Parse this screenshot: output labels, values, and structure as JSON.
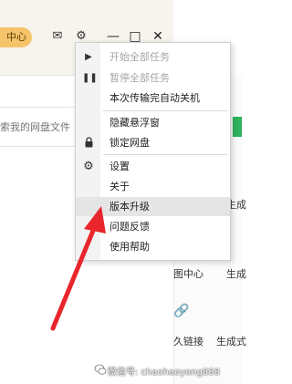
{
  "app": {
    "center_button_label": "中心",
    "mail_icon": "mail-icon",
    "settings_icon": "gear-icon",
    "minimize_label": "—",
    "maximize_label": "□",
    "close_label": "✕",
    "search_placeholder": "索我的网盘文件"
  },
  "side_panel": {
    "label_generate_1": "生成",
    "label_center": "图中心",
    "label_generate_2": "生成",
    "label_link": "久链接",
    "label_generate_3": "生成式"
  },
  "menu": {
    "items": [
      {
        "label": "开始全部任务",
        "icon": "play-icon",
        "glyph": "▶",
        "enabled": false
      },
      {
        "label": "暂停全部任务",
        "icon": "pause-icon",
        "glyph": "⏸",
        "enabled": false
      },
      {
        "label": "本次传输完自动关机",
        "icon": "",
        "glyph": "",
        "enabled": true
      },
      {
        "label": "隐藏悬浮窗",
        "icon": "",
        "glyph": "",
        "enabled": true
      },
      {
        "label": "锁定网盘",
        "icon": "lock-icon",
        "glyph": "🔒",
        "enabled": true
      },
      {
        "label": "设置",
        "icon": "gear-icon",
        "glyph": "⚙",
        "enabled": true
      },
      {
        "label": "关于",
        "icon": "",
        "glyph": "",
        "enabled": true
      },
      {
        "label": "版本升级",
        "icon": "",
        "glyph": "",
        "enabled": true,
        "highlighted": true
      },
      {
        "label": "问题反馈",
        "icon": "",
        "glyph": "",
        "enabled": true
      },
      {
        "label": "使用帮助",
        "icon": "",
        "glyph": "",
        "enabled": true
      }
    ]
  },
  "annotation": {
    "arrow_color": "#e8262c"
  },
  "watermark": {
    "text": "微信号: chaohaoyong888"
  },
  "colors": {
    "accent": "#f5c46a",
    "green": "#2fb15c"
  }
}
